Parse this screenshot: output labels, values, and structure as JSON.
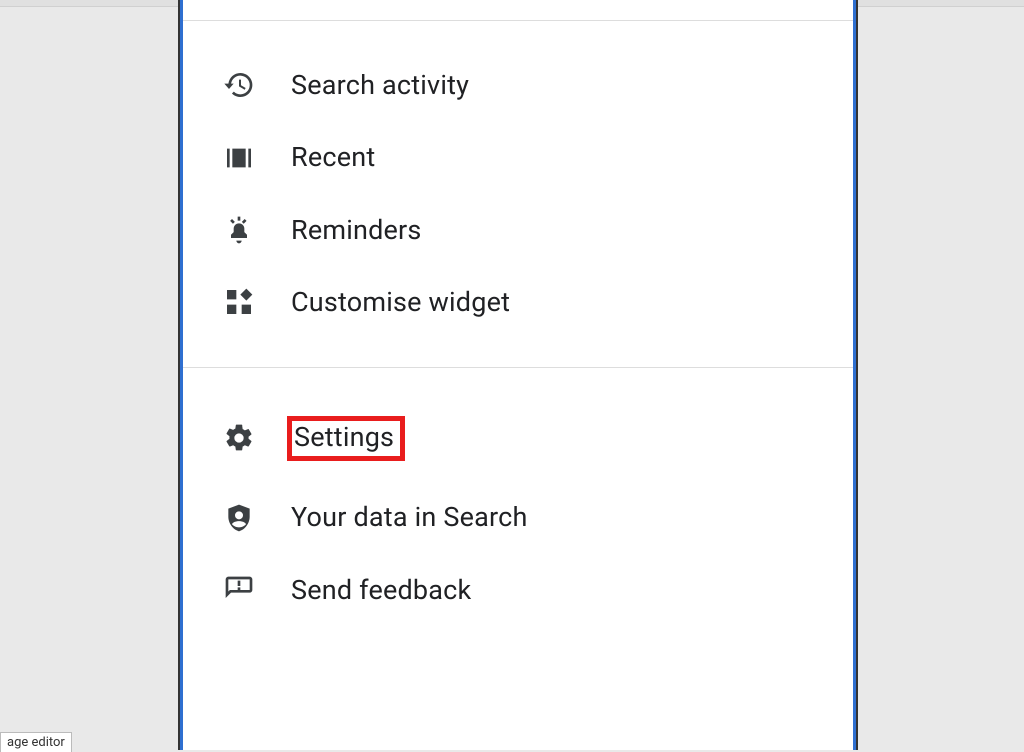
{
  "section1": {
    "items": [
      {
        "icon": "history-icon",
        "label": "Search activity"
      },
      {
        "icon": "recent-icon",
        "label": "Recent"
      },
      {
        "icon": "reminders-icon",
        "label": "Reminders"
      },
      {
        "icon": "widgets-icon",
        "label": "Customise widget"
      }
    ]
  },
  "section2": {
    "items": [
      {
        "icon": "gear-icon",
        "label": "Settings",
        "highlight": true
      },
      {
        "icon": "shield-icon",
        "label": "Your data in Search"
      },
      {
        "icon": "feedback-icon",
        "label": "Send feedback"
      }
    ]
  },
  "footer_caption": "age editor"
}
